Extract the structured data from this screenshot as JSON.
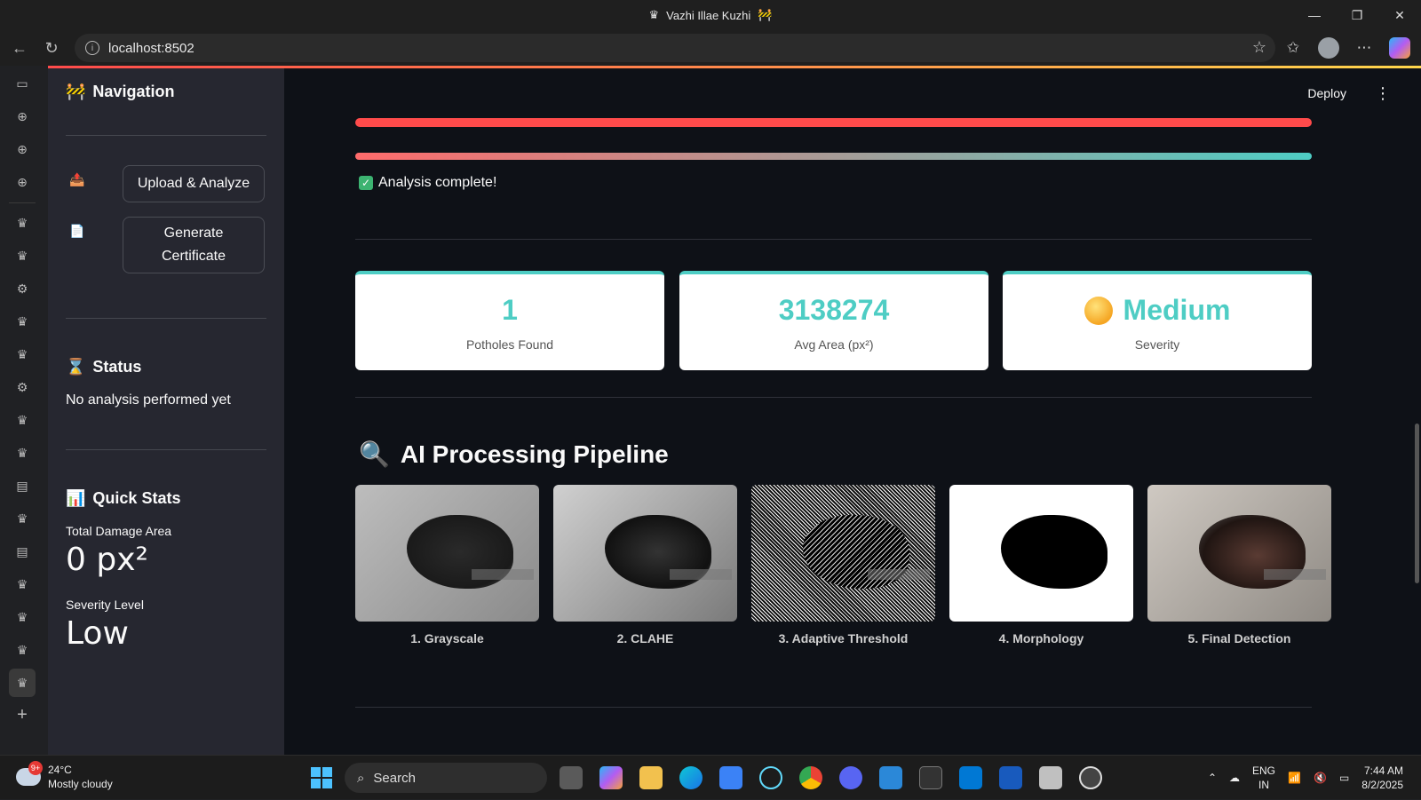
{
  "window": {
    "title": "Vazhi Illae Kuzhi",
    "controls": [
      "—",
      "❐",
      "✕"
    ]
  },
  "browser": {
    "url": "localhost:8502"
  },
  "sidebar": {
    "navigation_heading": "Navigation",
    "nav_buttons": [
      {
        "emoji": "📤",
        "label": "Upload & Analyze"
      },
      {
        "emoji": "📄",
        "label": "Generate Certificate"
      }
    ],
    "status_heading": "Status",
    "status_text": "No analysis performed yet",
    "quick_stats_heading": "Quick Stats",
    "total_damage_label": "Total Damage Area",
    "total_damage_value": "0 px²",
    "severity_level_label": "Severity Level",
    "severity_level_value": "Low"
  },
  "header": {
    "deploy_label": "Deploy"
  },
  "main": {
    "progress_red": 1.0,
    "progress_gradient": 1.0,
    "success_message": "Analysis complete!",
    "metrics": [
      {
        "value": "1",
        "label": "Potholes Found"
      },
      {
        "value": "3138274",
        "label": "Avg Area (px²)"
      },
      {
        "value": "Medium",
        "label": "Severity"
      }
    ],
    "pipeline_title": "AI Processing Pipeline",
    "pipeline_steps": [
      "1. Grayscale",
      "2. CLAHE",
      "3. Adaptive Threshold",
      "4. Morphology",
      "5. Final Detection"
    ]
  },
  "taskbar": {
    "weather_badge": "9+",
    "temperature": "24°C",
    "weather_desc": "Mostly cloudy",
    "search_label": "Search",
    "lang_top": "ENG",
    "lang_bottom": "IN",
    "time": "7:44 AM",
    "date": "8/2/2025"
  },
  "colors": {
    "accent_teal": "#4ecdc4",
    "accent_red": "#ff4b4b",
    "app_bg": "#0e1117",
    "sidebar_bg": "#262730"
  }
}
